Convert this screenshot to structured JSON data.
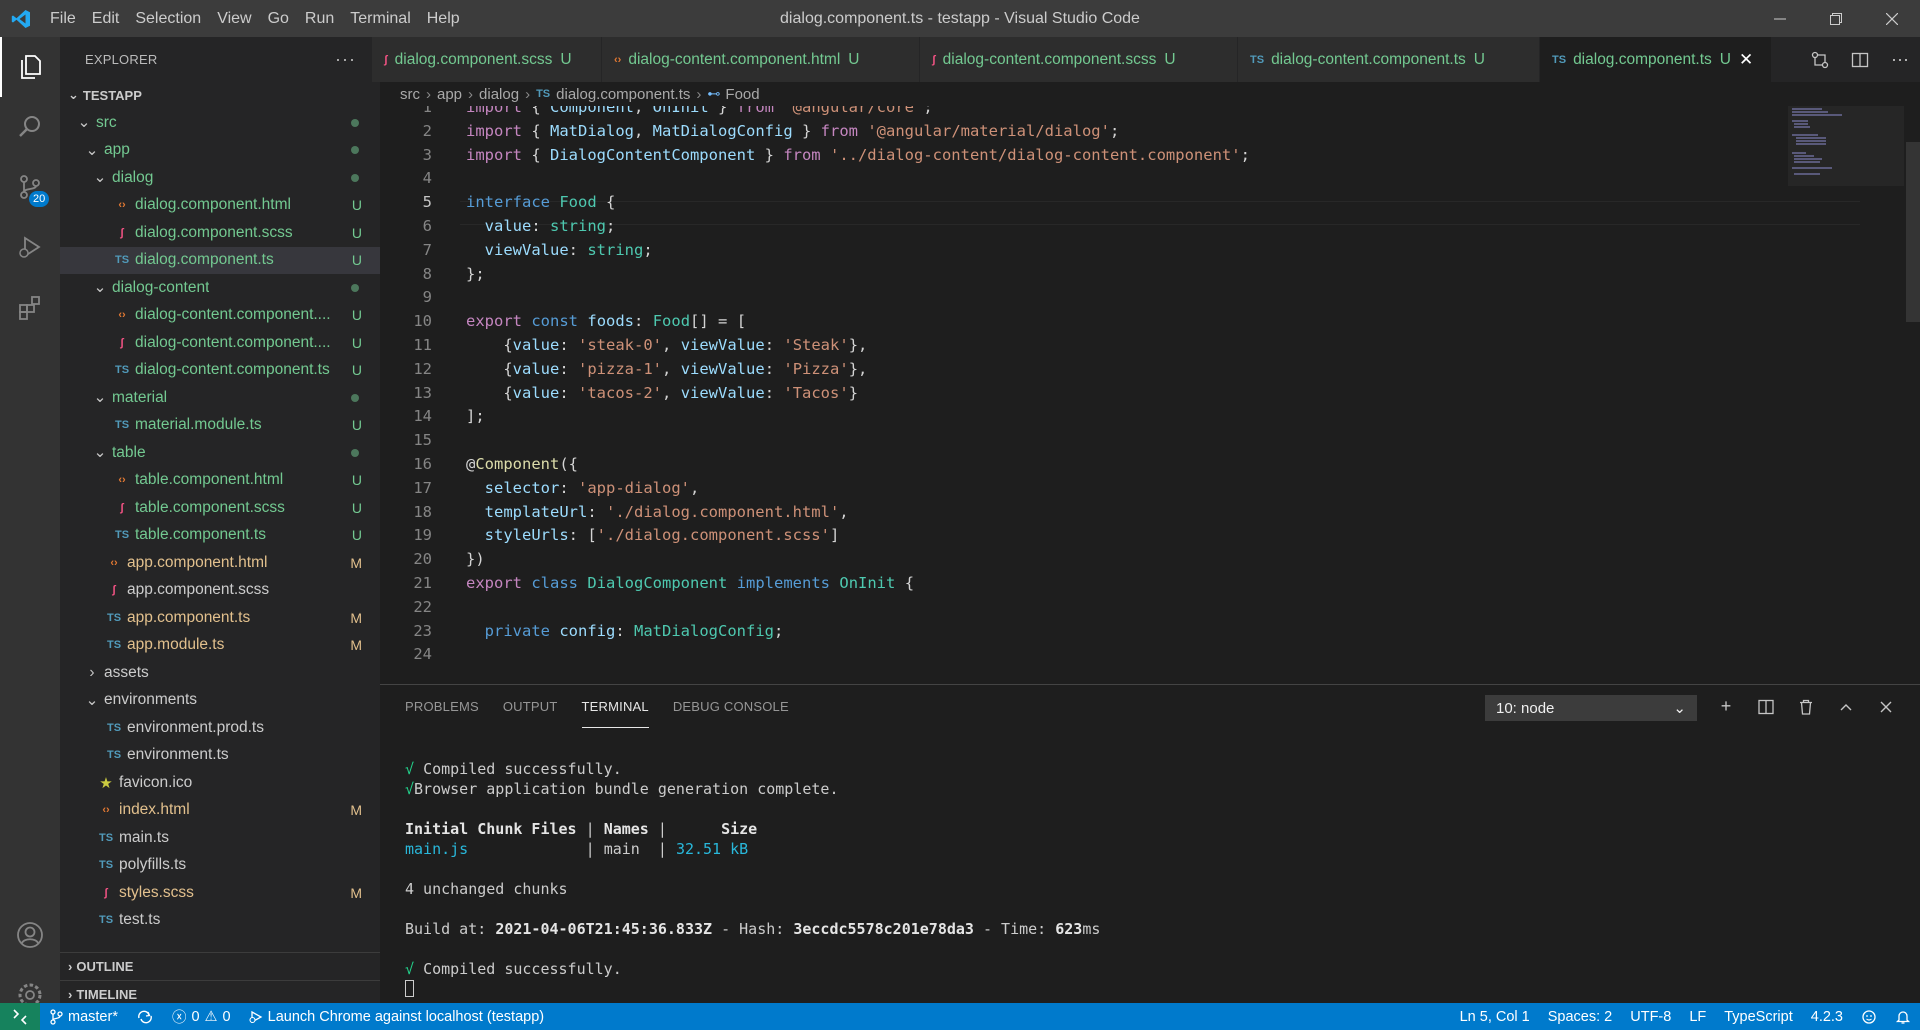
{
  "window": {
    "title": "dialog.component.ts - testapp - Visual Studio Code"
  },
  "menu": [
    "File",
    "Edit",
    "Selection",
    "View",
    "Go",
    "Run",
    "Terminal",
    "Help"
  ],
  "activity": {
    "scm_badge": "20"
  },
  "explorer": {
    "header": "EXPLORER",
    "more": "···",
    "root": "TESTAPP",
    "tree": [
      {
        "label": "src",
        "kind": "folder",
        "status": "dot"
      },
      {
        "label": "app",
        "kind": "folder",
        "status": "dot"
      },
      {
        "label": "dialog",
        "kind": "folder",
        "status": "dot"
      },
      {
        "label": "dialog.component.html",
        "kind": "html",
        "status": "U"
      },
      {
        "label": "dialog.component.scss",
        "kind": "scss",
        "status": "U"
      },
      {
        "label": "dialog.component.ts",
        "kind": "ts",
        "status": "U"
      },
      {
        "label": "dialog-content",
        "kind": "folder",
        "status": "dot"
      },
      {
        "label": "dialog-content.component....",
        "kind": "html",
        "status": "U"
      },
      {
        "label": "dialog-content.component....",
        "kind": "scss",
        "status": "U"
      },
      {
        "label": "dialog-content.component.ts",
        "kind": "ts",
        "status": "U"
      },
      {
        "label": "material",
        "kind": "folder",
        "status": "dot"
      },
      {
        "label": "material.module.ts",
        "kind": "ts",
        "status": "U"
      },
      {
        "label": "table",
        "kind": "folder",
        "status": "dot"
      },
      {
        "label": "table.component.html",
        "kind": "html",
        "status": "U"
      },
      {
        "label": "table.component.scss",
        "kind": "scss",
        "status": "U"
      },
      {
        "label": "table.component.ts",
        "kind": "ts",
        "status": "U"
      },
      {
        "label": "app.component.html",
        "kind": "html",
        "status": "M"
      },
      {
        "label": "app.component.scss",
        "kind": "scss",
        "status": ""
      },
      {
        "label": "app.component.ts",
        "kind": "ts",
        "status": "M"
      },
      {
        "label": "app.module.ts",
        "kind": "ts",
        "status": "M"
      },
      {
        "label": "assets",
        "kind": "folder-closed",
        "status": ""
      },
      {
        "label": "environments",
        "kind": "folder",
        "status": ""
      },
      {
        "label": "environment.prod.ts",
        "kind": "ts",
        "status": ""
      },
      {
        "label": "environment.ts",
        "kind": "ts",
        "status": ""
      },
      {
        "label": "favicon.ico",
        "kind": "star",
        "status": ""
      },
      {
        "label": "index.html",
        "kind": "html",
        "status": "M"
      },
      {
        "label": "main.ts",
        "kind": "ts",
        "status": ""
      },
      {
        "label": "polyfills.ts",
        "kind": "ts",
        "status": ""
      },
      {
        "label": "styles.scss",
        "kind": "scss",
        "status": "M"
      },
      {
        "label": "test.ts",
        "kind": "ts",
        "status": ""
      }
    ],
    "outline": "OUTLINE",
    "timeline": "TIMELINE"
  },
  "tabs": [
    {
      "label": "dialog.component.scss",
      "icon": "scss",
      "status": "U",
      "active": false
    },
    {
      "label": "dialog-content.component.html",
      "icon": "html",
      "status": "U",
      "active": false
    },
    {
      "label": "dialog-content.component.scss",
      "icon": "scss",
      "status": "U",
      "active": false
    },
    {
      "label": "dialog-content.component.ts",
      "icon": "ts",
      "status": "U",
      "active": false
    },
    {
      "label": "dialog.component.ts",
      "icon": "ts",
      "status": "U",
      "active": true
    }
  ],
  "breadcrumb": {
    "parts": [
      "src",
      "app",
      "dialog"
    ],
    "file": "dialog.component.ts",
    "symbol": "Food",
    "ts_tag": "TS"
  },
  "editor": {
    "current_line": 5,
    "lines": [
      [
        [
          "k",
          "import"
        ],
        [
          "p",
          " { "
        ],
        [
          "v",
          "Component"
        ],
        [
          "p",
          ", "
        ],
        [
          "v",
          "OnInit"
        ],
        [
          "p",
          " } "
        ],
        [
          "k",
          "from"
        ],
        [
          "p",
          " "
        ],
        [
          "s",
          "'@angular/core'"
        ],
        [
          "p",
          ";"
        ]
      ],
      [
        [
          "k",
          "import"
        ],
        [
          "p",
          " { "
        ],
        [
          "v",
          "MatDialog"
        ],
        [
          "p",
          ", "
        ],
        [
          "v",
          "MatDialogConfig"
        ],
        [
          "p",
          " } "
        ],
        [
          "k",
          "from"
        ],
        [
          "p",
          " "
        ],
        [
          "s",
          "'@angular/material/dialog'"
        ],
        [
          "p",
          ";"
        ]
      ],
      [
        [
          "k",
          "import"
        ],
        [
          "p",
          " { "
        ],
        [
          "v",
          "DialogContentComponent"
        ],
        [
          "p",
          " } "
        ],
        [
          "k",
          "from"
        ],
        [
          "p",
          " "
        ],
        [
          "s",
          "'../dialog-content/dialog-content.component'"
        ],
        [
          "p",
          ";"
        ]
      ],
      [],
      [
        [
          "b",
          "interface"
        ],
        [
          "p",
          " "
        ],
        [
          "t",
          "Food"
        ],
        [
          "p",
          " {"
        ]
      ],
      [
        [
          "p",
          "  "
        ],
        [
          "v",
          "value"
        ],
        [
          "p",
          ": "
        ],
        [
          "t",
          "string"
        ],
        [
          "p",
          ";"
        ]
      ],
      [
        [
          "p",
          "  "
        ],
        [
          "v",
          "viewValue"
        ],
        [
          "p",
          ": "
        ],
        [
          "t",
          "string"
        ],
        [
          "p",
          ";"
        ]
      ],
      [
        [
          "p",
          "};"
        ]
      ],
      [],
      [
        [
          "k",
          "export"
        ],
        [
          "p",
          " "
        ],
        [
          "b",
          "const"
        ],
        [
          "p",
          " "
        ],
        [
          "v",
          "foods"
        ],
        [
          "p",
          ": "
        ],
        [
          "t",
          "Food"
        ],
        [
          "p",
          "[] = ["
        ]
      ],
      [
        [
          "p",
          "    {"
        ],
        [
          "v",
          "value"
        ],
        [
          "p",
          ": "
        ],
        [
          "s",
          "'steak-0'"
        ],
        [
          "p",
          ", "
        ],
        [
          "v",
          "viewValue"
        ],
        [
          "p",
          ": "
        ],
        [
          "s",
          "'Steak'"
        ],
        [
          "p",
          "},"
        ]
      ],
      [
        [
          "p",
          "    {"
        ],
        [
          "v",
          "value"
        ],
        [
          "p",
          ": "
        ],
        [
          "s",
          "'pizza-1'"
        ],
        [
          "p",
          ", "
        ],
        [
          "v",
          "viewValue"
        ],
        [
          "p",
          ": "
        ],
        [
          "s",
          "'Pizza'"
        ],
        [
          "p",
          "},"
        ]
      ],
      [
        [
          "p",
          "    {"
        ],
        [
          "v",
          "value"
        ],
        [
          "p",
          ": "
        ],
        [
          "s",
          "'tacos-2'"
        ],
        [
          "p",
          ", "
        ],
        [
          "v",
          "viewValue"
        ],
        [
          "p",
          ": "
        ],
        [
          "s",
          "'Tacos'"
        ],
        [
          "p",
          "}"
        ]
      ],
      [
        [
          "p",
          "];"
        ]
      ],
      [],
      [
        [
          "p",
          "@"
        ],
        [
          "f",
          "Component"
        ],
        [
          "p",
          "({"
        ]
      ],
      [
        [
          "p",
          "  "
        ],
        [
          "v",
          "selector"
        ],
        [
          "p",
          ": "
        ],
        [
          "s",
          "'app-dialog'"
        ],
        [
          "p",
          ","
        ]
      ],
      [
        [
          "p",
          "  "
        ],
        [
          "v",
          "templateUrl"
        ],
        [
          "p",
          ": "
        ],
        [
          "s",
          "'./dialog.component.html'"
        ],
        [
          "p",
          ","
        ]
      ],
      [
        [
          "p",
          "  "
        ],
        [
          "v",
          "styleUrls"
        ],
        [
          "p",
          ": ["
        ],
        [
          "s",
          "'./dialog.component.scss'"
        ],
        [
          "p",
          "]"
        ]
      ],
      [
        [
          "p",
          "})"
        ]
      ],
      [
        [
          "k",
          "export"
        ],
        [
          "p",
          " "
        ],
        [
          "b",
          "class"
        ],
        [
          "p",
          " "
        ],
        [
          "t",
          "DialogComponent"
        ],
        [
          "p",
          " "
        ],
        [
          "b",
          "implements"
        ],
        [
          "p",
          " "
        ],
        [
          "t",
          "OnInit"
        ],
        [
          "p",
          " {"
        ]
      ],
      [],
      [
        [
          "p",
          "  "
        ],
        [
          "b",
          "private"
        ],
        [
          "p",
          " "
        ],
        [
          "v",
          "config"
        ],
        [
          "p",
          ": "
        ],
        [
          "t",
          "MatDialogConfig"
        ],
        [
          "p",
          ";"
        ]
      ],
      []
    ]
  },
  "panel": {
    "tabs": [
      "PROBLEMS",
      "OUTPUT",
      "TERMINAL",
      "DEBUG CONSOLE"
    ],
    "active_tab": "TERMINAL",
    "terminal_select": "10: node",
    "terminal": {
      "compiled_1": "Compiled successfully.",
      "bundle": "Browser application bundle generation complete.",
      "th_files": "Initial Chunk Files",
      "th_names": "Names",
      "th_size": "Size",
      "row_file": "main.js",
      "row_name": "main",
      "row_size": "32.51 kB",
      "unchanged": "4 unchanged chunks",
      "build_at_label": "Build at: ",
      "build_at": "2021-04-06T21:45:36.833Z",
      "hash_label": " - Hash: ",
      "hash": "3eccdc5578c201e78da3",
      "time_label": " - Time: ",
      "time": "623",
      "time_unit": "ms",
      "compiled_2": "Compiled successfully.",
      "check": "√"
    }
  },
  "statusbar": {
    "branch": "master*",
    "errors": "0",
    "warnings": "0",
    "launch": "Launch Chrome against localhost (testapp)",
    "position": "Ln 5, Col 1",
    "spaces": "Spaces: 2",
    "encoding": "UTF-8",
    "eol": "LF",
    "language": "TypeScript",
    "ts_version": "4.2.3"
  },
  "colors": {
    "accent": "#007acc",
    "untracked": "#73c991",
    "modified": "#e2c08d",
    "remote": "#16825d"
  }
}
